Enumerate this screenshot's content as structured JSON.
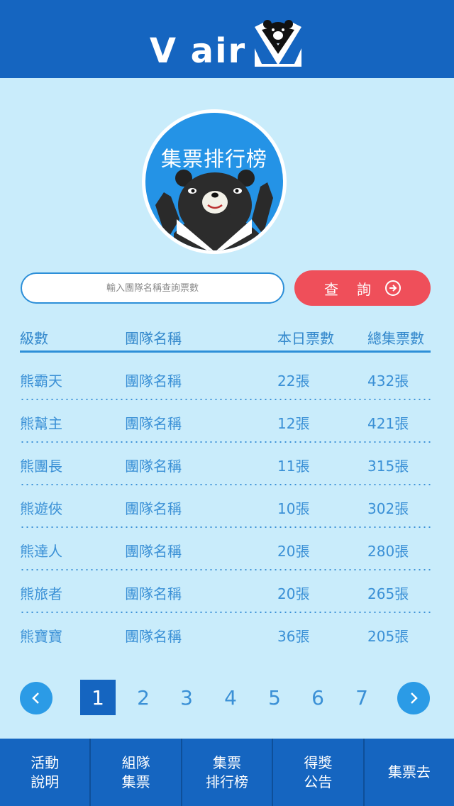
{
  "header": {
    "logo_text": "V air"
  },
  "badge": {
    "title": "集票排行榜"
  },
  "search": {
    "placeholder": "輸入團隊名稱查詢票數",
    "button_label": "查詢"
  },
  "table": {
    "headers": [
      "級數",
      "團隊名稱",
      "本日票數",
      "總集票數"
    ],
    "rows": [
      {
        "level": "熊霸天",
        "team": "團隊名稱",
        "today": "22張",
        "total": "432張"
      },
      {
        "level": "熊幫主",
        "team": "團隊名稱",
        "today": "12張",
        "total": "421張"
      },
      {
        "level": "熊團長",
        "team": "團隊名稱",
        "today": "11張",
        "total": "315張"
      },
      {
        "level": "熊遊俠",
        "team": "團隊名稱",
        "today": "10張",
        "total": "302張"
      },
      {
        "level": "熊達人",
        "team": "團隊名稱",
        "today": "20張",
        "total": "280張"
      },
      {
        "level": "熊旅者",
        "team": "團隊名稱",
        "today": "20張",
        "total": "265張"
      },
      {
        "level": "熊寶寶",
        "team": "團隊名稱",
        "today": "36張",
        "total": "205張"
      }
    ]
  },
  "pagination": {
    "pages": [
      "1",
      "2",
      "3",
      "4",
      "5",
      "6",
      "7"
    ],
    "current": "1"
  },
  "tabs": [
    "活動\n說明",
    "組隊\n集票",
    "集票\n排行榜",
    "得獎\n公告",
    "集票去"
  ],
  "colors": {
    "primary": "#1565c0",
    "background": "#c9ecfb",
    "accent": "#ef4f5a",
    "text": "#3a90d6"
  }
}
